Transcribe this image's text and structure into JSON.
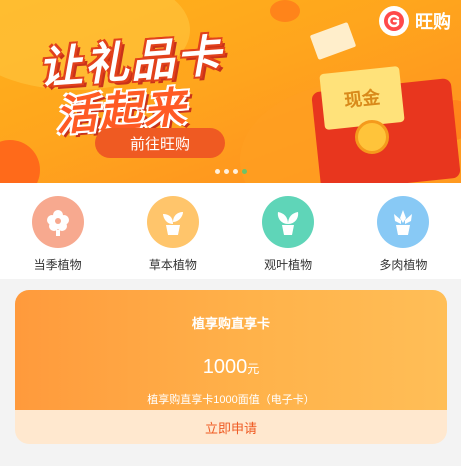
{
  "banner": {
    "brand_name": "旺购",
    "slogan_line1": "让礼品卡",
    "slogan_line2": "活起来",
    "cta_label": "前往旺购",
    "card_word": "现金",
    "carousel_dots": 4,
    "active_dot": 4
  },
  "categories": [
    {
      "label": "当季植物",
      "icon": "flower-icon",
      "color": "#f7a98f"
    },
    {
      "label": "草本植物",
      "icon": "sprout-icon",
      "color": "#ffc56b"
    },
    {
      "label": "观叶植物",
      "icon": "leafy-plant-icon",
      "color": "#5fd5b8"
    },
    {
      "label": "多肉植物",
      "icon": "succulent-icon",
      "color": "#88c9f5"
    }
  ],
  "product_card": {
    "title": "植享购直享卡",
    "price": "1000",
    "unit": "元",
    "description": "植享购直享卡1000面值（电子卡）",
    "button_label": "立即申请"
  },
  "colors": {
    "accent": "#ef5a22",
    "banner_orange": "#ffa51d",
    "card_gradient_start": "#ff9a3c",
    "card_gradient_end": "#ffbe57",
    "button_bg": "#ffe8cf"
  }
}
